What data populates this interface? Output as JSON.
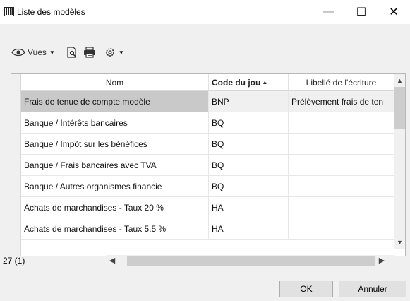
{
  "window": {
    "title": "Liste des modèles",
    "minimize_glyph": "—",
    "maximize_glyph": "☐",
    "close_glyph": "✕"
  },
  "toolbar": {
    "views_label": "Vues"
  },
  "grid": {
    "columns": [
      "Nom",
      "Code du jou",
      "Libellé de l'écriture"
    ],
    "sorted_column": "Code du jou",
    "sort_direction": "ascending",
    "rows": [
      {
        "nom": "Frais de tenue de compte modèle",
        "code": "BNP",
        "libelle": "Prélèvement frais de ten",
        "selected": true
      },
      {
        "nom": "Banque / Intérêts bancaires",
        "code": "BQ",
        "libelle": ""
      },
      {
        "nom": "Banque / Impôt sur les bénéfices",
        "code": "BQ",
        "libelle": ""
      },
      {
        "nom": "Banque / Frais bancaires avec TVA",
        "code": "BQ",
        "libelle": ""
      },
      {
        "nom": "Banque / Autres organismes financie",
        "code": "BQ",
        "libelle": ""
      },
      {
        "nom": "Achats de marchandises - Taux 20 %",
        "code": "HA",
        "libelle": ""
      },
      {
        "nom": "Achats de marchandises - Taux 5.5 %",
        "code": "HA",
        "libelle": ""
      }
    ]
  },
  "status": {
    "count": "27 (1)"
  },
  "buttons": {
    "ok": "OK",
    "cancel": "Annuler"
  },
  "colors": {
    "selected_row": "#c9c9c9",
    "dialog_background": "#f0f0f0"
  }
}
